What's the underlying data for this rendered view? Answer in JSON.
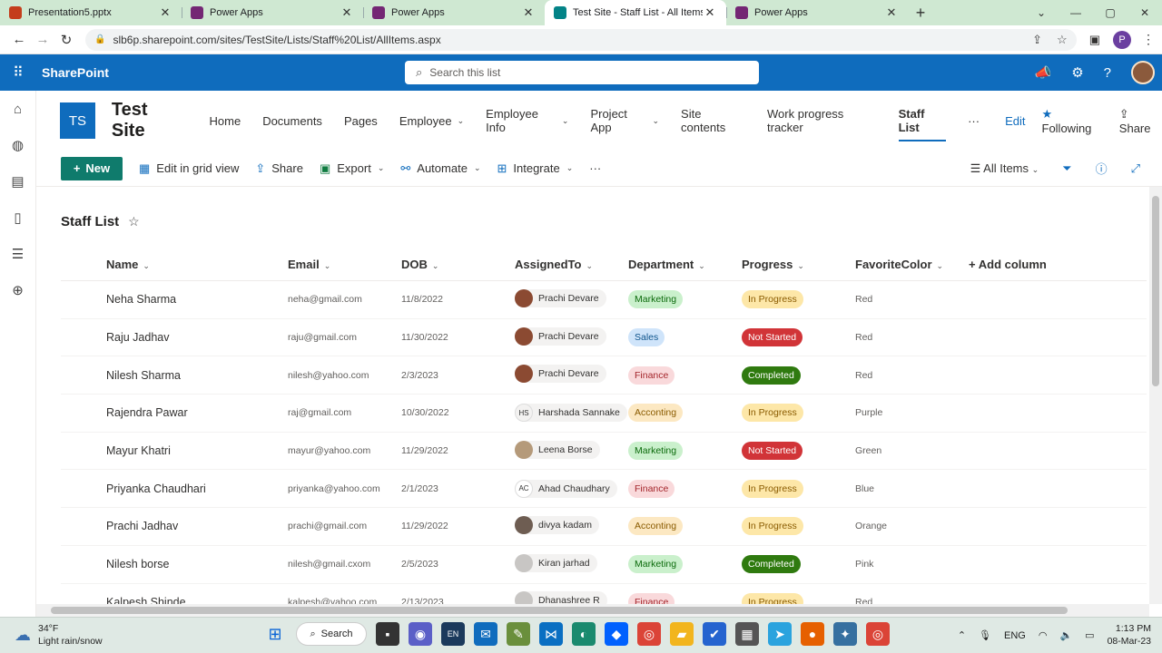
{
  "browser": {
    "tabs": [
      {
        "title": "Presentation5.pptx",
        "icon_color": "#c43e1c",
        "active": false
      },
      {
        "title": "Power Apps",
        "icon_color": "#742774",
        "active": false
      },
      {
        "title": "Power Apps",
        "icon_color": "#742774",
        "active": false
      },
      {
        "title": "Test Site - Staff List - All Items",
        "icon_color": "#038387",
        "active": true
      },
      {
        "title": "Power Apps",
        "icon_color": "#742774",
        "active": false
      }
    ],
    "url": "slb6p.sharepoint.com/sites/TestSite/Lists/Staff%20List/AllItems.aspx",
    "profile_initial": "P"
  },
  "suite": {
    "brand": "SharePoint",
    "search_placeholder": "Search this list"
  },
  "site": {
    "logo_initials": "TS",
    "name": "Test Site",
    "nav": [
      "Home",
      "Documents",
      "Pages",
      "Employee",
      "Employee Info",
      "Project App",
      "Site contents",
      "Work progress tracker",
      "Staff List"
    ],
    "nav_dropdowns": [
      "Employee",
      "Employee Info",
      "Project App"
    ],
    "current_nav": "Staff List",
    "edit_label": "Edit",
    "following_label": "Following",
    "share_label": "Share"
  },
  "command_bar": {
    "new_label": "New",
    "edit_grid_label": "Edit in grid view",
    "share_label": "Share",
    "export_label": "Export",
    "automate_label": "Automate",
    "integrate_label": "Integrate",
    "view_label": "All Items"
  },
  "list": {
    "title": "Staff List",
    "columns": [
      "Name",
      "Email",
      "DOB",
      "AssignedTo",
      "Department",
      "Progress",
      "FavoriteColor"
    ],
    "add_column_label": "Add column",
    "rows": [
      {
        "name": "Neha Sharma",
        "email": "neha@gmail.com",
        "dob": "11/8/2022",
        "assigned": "Prachi Devare",
        "avatar": "PD",
        "dept": "Marketing",
        "progress": "In Progress",
        "color": "Red"
      },
      {
        "name": "Raju Jadhav",
        "email": "raju@gmail.com",
        "dob": "11/30/2022",
        "assigned": "Prachi Devare",
        "avatar": "PD",
        "dept": "Sales",
        "progress": "Not Started",
        "color": "Red"
      },
      {
        "name": "Nilesh Sharma",
        "email": "nilesh@yahoo.com",
        "dob": "2/3/2023",
        "assigned": "Prachi Devare",
        "avatar": "PD",
        "dept": "Finance",
        "progress": "Completed",
        "color": "Red"
      },
      {
        "name": "Rajendra Pawar",
        "email": "raj@gmail.com",
        "dob": "10/30/2022",
        "assigned": "Harshada Sannake",
        "avatar": "HS",
        "dept": "Acconting",
        "progress": "In Progress",
        "color": "Purple"
      },
      {
        "name": "Mayur Khatri",
        "email": "mayur@yahoo.com",
        "dob": "11/29/2022",
        "assigned": "Leena Borse",
        "avatar": "LB",
        "dept": "Marketing",
        "progress": "Not Started",
        "color": "Green"
      },
      {
        "name": "Priyanka Chaudhari",
        "email": "priyanka@yahoo.com",
        "dob": "2/1/2023",
        "assigned": "Ahad Chaudhary",
        "avatar": "AC",
        "dept": "Finance",
        "progress": "In Progress",
        "color": "Blue"
      },
      {
        "name": "Prachi Jadhav",
        "email": "prachi@gmail.com",
        "dob": "11/29/2022",
        "assigned": "divya kadam",
        "avatar": "DK",
        "dept": "Acconting",
        "progress": "In Progress",
        "color": "Orange"
      },
      {
        "name": "Nilesh borse",
        "email": "nilesh@gmail.cxom",
        "dob": "2/5/2023",
        "assigned": "Kiran jarhad",
        "avatar": "KJ",
        "dept": "Marketing",
        "progress": "Completed",
        "color": "Pink"
      },
      {
        "name": "Kalpesh Shinde",
        "email": "kalpesh@yahoo.com",
        "dob": "2/13/2023",
        "assigned": "Dhanashree R",
        "avatar": "DR",
        "dept": "Finance",
        "progress": "In Progress",
        "color": "Red"
      }
    ]
  },
  "colors": {
    "dept": {
      "Marketing": {
        "bg": "#caf0cc",
        "fg": "#0b6a0b"
      },
      "Sales": {
        "bg": "#cfe4fa",
        "fg": "#0f548c"
      },
      "Finance": {
        "bg": "#f9d9db",
        "fg": "#a4262c"
      },
      "Acconting": {
        "bg": "#fce8c2",
        "fg": "#8a5b00"
      }
    },
    "progress": {
      "In Progress": {
        "bg": "#fde7a8",
        "fg": "#8a5b00"
      },
      "Not Started": {
        "bg": "#d13438",
        "fg": "#ffffff"
      },
      "Completed": {
        "bg": "#2f7a0f",
        "fg": "#ffffff"
      }
    },
    "avatar": {
      "PD": "#8b4a32",
      "HS": "#f3f2f1",
      "LB": "#b59a7a",
      "AC": "#ffffff",
      "DK": "#6e5d52",
      "KJ": "#c8c6c4",
      "DR": "#c8c6c4"
    }
  },
  "taskbar": {
    "temperature": "34°F",
    "weather": "Light rain/snow",
    "search_label": "Search",
    "language": "ENG",
    "time": "1:13 PM",
    "date": "08-Mar-23"
  }
}
